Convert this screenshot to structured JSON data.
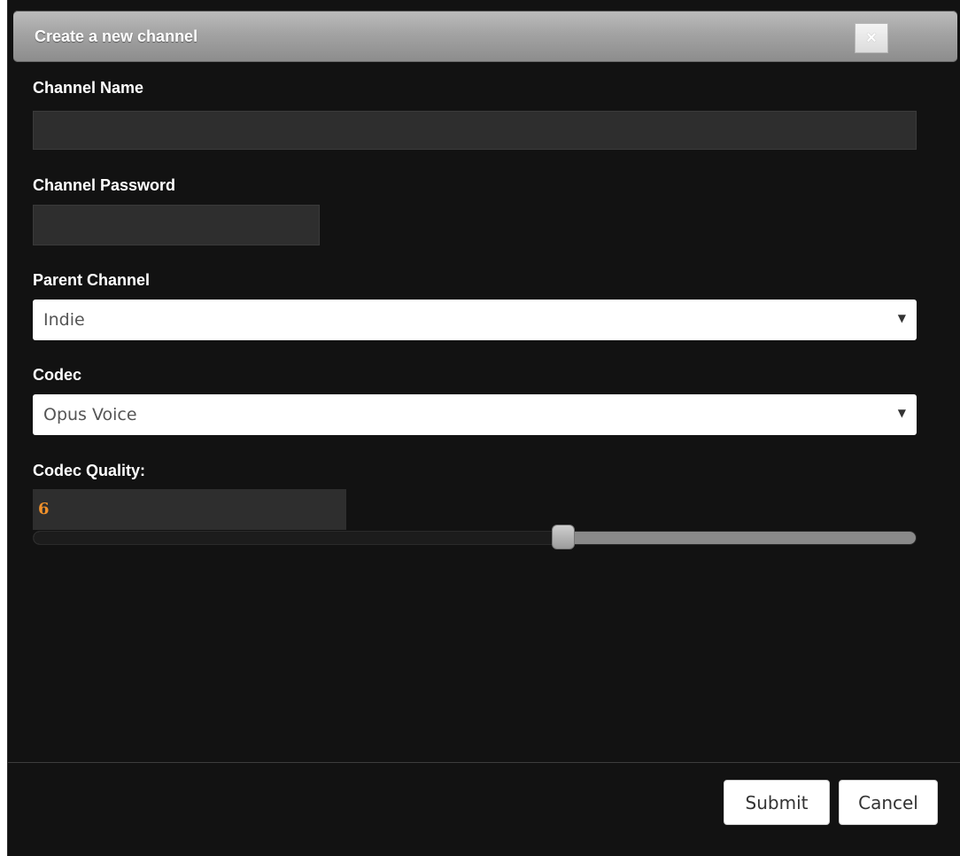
{
  "dialog": {
    "title": "Create a new channel",
    "close_icon": "close-icon",
    "close_glyph": "×"
  },
  "form": {
    "channel_name": {
      "label": "Channel Name",
      "value": ""
    },
    "channel_password": {
      "label": "Channel Password",
      "value": ""
    },
    "parent_channel": {
      "label": "Parent Channel",
      "selected": "Indie"
    },
    "codec": {
      "label": "Codec",
      "selected": "Opus Voice"
    },
    "codec_quality": {
      "label": "Codec Quality:",
      "value": "6",
      "slider_fraction": 0.6
    }
  },
  "footer": {
    "submit_label": "Submit",
    "cancel_label": "Cancel"
  },
  "colors": {
    "background": "#121212",
    "quality_value": "#f0902a"
  }
}
